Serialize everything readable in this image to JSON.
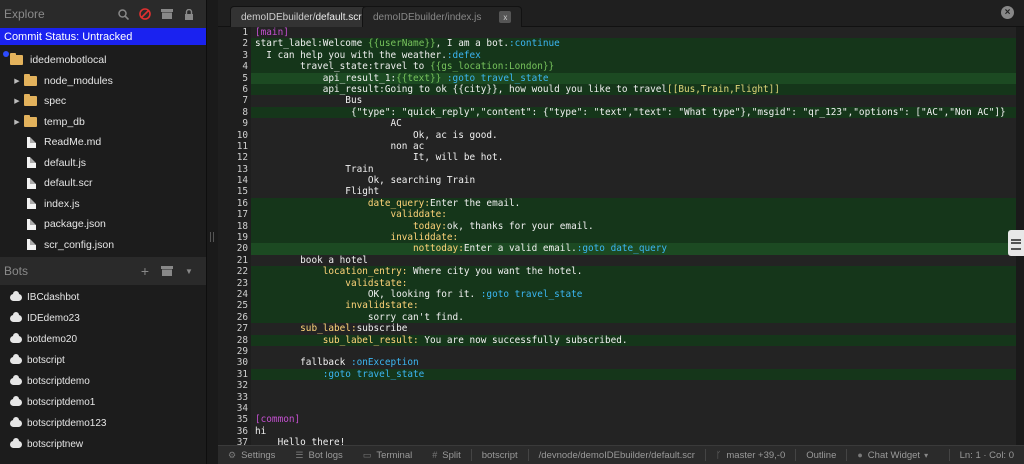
{
  "sidebar": {
    "explore_title": "Explore",
    "commit_status": "Commit Status: Untracked",
    "tree": [
      {
        "name": "idedemobotlocal",
        "kind": "folder",
        "level": 0,
        "arrow": ""
      },
      {
        "name": "node_modules",
        "kind": "folder",
        "level": 1,
        "arrow": "▶"
      },
      {
        "name": "spec",
        "kind": "folder",
        "level": 1,
        "arrow": "▶"
      },
      {
        "name": "temp_db",
        "kind": "folder",
        "level": 1,
        "arrow": "▶"
      },
      {
        "name": "ReadMe.md",
        "kind": "file",
        "level": 1,
        "arrow": ""
      },
      {
        "name": "default.js",
        "kind": "file",
        "level": 1,
        "arrow": ""
      },
      {
        "name": "default.scr",
        "kind": "file",
        "level": 1,
        "arrow": ""
      },
      {
        "name": "index.js",
        "kind": "file",
        "level": 1,
        "arrow": ""
      },
      {
        "name": "package.json",
        "kind": "file",
        "level": 1,
        "arrow": ""
      },
      {
        "name": "scr_config.json",
        "kind": "file",
        "level": 1,
        "arrow": ""
      }
    ],
    "bots_title": "Bots",
    "bots": [
      "IBCdashbot",
      "IDEdemo23",
      "botdemo20",
      "botscript",
      "botscriptdemo",
      "botscriptdemo1",
      "botscriptdemo123",
      "botscriptnew"
    ]
  },
  "tabs": [
    {
      "prefix": "demoIDEbuilder/",
      "file": "default.scr",
      "active": true
    },
    {
      "prefix": "demoIDEbuilder/",
      "file": "index.js",
      "active": false
    }
  ],
  "code_lines": [
    {
      "n": "1",
      "hl": "",
      "segs": [
        {
          "t": "[main]",
          "c": "c-sect"
        }
      ]
    },
    {
      "n": "2",
      "hl": "hl",
      "segs": [
        {
          "t": "start_label:",
          "c": ""
        },
        {
          "t": "Welcome ",
          "c": ""
        },
        {
          "t": "{{userName}}",
          "c": "c-var"
        },
        {
          "t": ", I am a bot.",
          "c": ""
        },
        {
          "t": ":continue",
          "c": "c-goto"
        }
      ]
    },
    {
      "n": "3",
      "hl": "hl",
      "segs": [
        {
          "t": "  I can help you with the weather.",
          "c": ""
        },
        {
          "t": ":defex",
          "c": "c-goto"
        }
      ]
    },
    {
      "n": "4",
      "hl": "hl",
      "segs": [
        {
          "t": "        travel_state:",
          "c": ""
        },
        {
          "t": "travel to ",
          "c": ""
        },
        {
          "t": "{{gs_location:London}}",
          "c": "c-var"
        }
      ]
    },
    {
      "n": "5",
      "hl": "hl2",
      "segs": [
        {
          "t": "            api_result_1:",
          "c": ""
        },
        {
          "t": "{{text}}",
          "c": "c-var"
        },
        {
          "t": " :goto travel_state",
          "c": "c-goto"
        }
      ]
    },
    {
      "n": "6",
      "hl": "hl",
      "segs": [
        {
          "t": "            api_result:",
          "c": ""
        },
        {
          "t": "Going to ok {{city}}, how would you like to travel",
          "c": ""
        },
        {
          "t": "[[Bus,Train,Flight]]",
          "c": "c-brk"
        }
      ]
    },
    {
      "n": "7",
      "hl": "",
      "segs": [
        {
          "t": "                Bus",
          "c": ""
        }
      ]
    },
    {
      "n": "8",
      "hl": "hl",
      "segs": [
        {
          "t": "                 {\"type\": \"quick_reply\",\"content\": {\"type\": \"text\",\"text\": \"What type\"},\"msgid\": \"qr_123\",\"options\": [\"AC\",\"Non AC\"]}",
          "c": ""
        }
      ]
    },
    {
      "n": "9",
      "hl": "",
      "segs": [
        {
          "t": "                        AC",
          "c": ""
        }
      ]
    },
    {
      "n": "10",
      "hl": "",
      "segs": [
        {
          "t": "                            Ok, ac is good.",
          "c": ""
        }
      ]
    },
    {
      "n": "11",
      "hl": "",
      "segs": [
        {
          "t": "                        non ac",
          "c": ""
        }
      ]
    },
    {
      "n": "12",
      "hl": "",
      "segs": [
        {
          "t": "                            It, will be hot.",
          "c": ""
        }
      ]
    },
    {
      "n": "13",
      "hl": "",
      "segs": [
        {
          "t": "                Train",
          "c": ""
        }
      ]
    },
    {
      "n": "14",
      "hl": "",
      "segs": [
        {
          "t": "                    Ok, searching Train",
          "c": ""
        }
      ]
    },
    {
      "n": "15",
      "hl": "",
      "segs": [
        {
          "t": "                Flight",
          "c": ""
        }
      ]
    },
    {
      "n": "16",
      "hl": "hl",
      "segs": [
        {
          "t": "                    date_query:",
          "c": "c-label"
        },
        {
          "t": "Enter the email.",
          "c": ""
        }
      ]
    },
    {
      "n": "17",
      "hl": "hl",
      "segs": [
        {
          "t": "                        validdate:",
          "c": "c-label"
        }
      ]
    },
    {
      "n": "18",
      "hl": "hl",
      "segs": [
        {
          "t": "                            today:",
          "c": "c-label"
        },
        {
          "t": "ok, thanks for your email.",
          "c": ""
        }
      ]
    },
    {
      "n": "19",
      "hl": "hl",
      "segs": [
        {
          "t": "                        invaliddate:",
          "c": "c-label"
        }
      ]
    },
    {
      "n": "20",
      "hl": "hl2",
      "segs": [
        {
          "t": "                            nottoday:",
          "c": "c-label"
        },
        {
          "t": "Enter a valid email.",
          "c": ""
        },
        {
          "t": ":goto date_query",
          "c": "c-goto"
        }
      ]
    },
    {
      "n": "21",
      "hl": "",
      "segs": [
        {
          "t": "        book a hotel",
          "c": ""
        }
      ]
    },
    {
      "n": "22",
      "hl": "hl",
      "segs": [
        {
          "t": "            location_entry:",
          "c": "c-label"
        },
        {
          "t": " Where city you want the hotel.",
          "c": ""
        }
      ]
    },
    {
      "n": "23",
      "hl": "hl",
      "segs": [
        {
          "t": "                validstate:",
          "c": "c-label"
        }
      ]
    },
    {
      "n": "24",
      "hl": "hl",
      "segs": [
        {
          "t": "                    OK, looking for it. ",
          "c": ""
        },
        {
          "t": ":goto travel_state",
          "c": "c-goto"
        }
      ]
    },
    {
      "n": "25",
      "hl": "hl",
      "segs": [
        {
          "t": "                invalidstate:",
          "c": "c-label"
        }
      ]
    },
    {
      "n": "26",
      "hl": "hl",
      "segs": [
        {
          "t": "                    sorry can't find.",
          "c": ""
        }
      ]
    },
    {
      "n": "27",
      "hl": "",
      "segs": [
        {
          "t": "        sub_label:",
          "c": "c-label"
        },
        {
          "t": "subscribe",
          "c": ""
        }
      ]
    },
    {
      "n": "28",
      "hl": "hl",
      "segs": [
        {
          "t": "            sub_label_result:",
          "c": "c-label"
        },
        {
          "t": " You are now successfully subscribed.",
          "c": ""
        }
      ]
    },
    {
      "n": "29",
      "hl": "",
      "segs": [
        {
          "t": "",
          "c": ""
        }
      ]
    },
    {
      "n": "30",
      "hl": "",
      "segs": [
        {
          "t": "        fallback ",
          "c": ""
        },
        {
          "t": ":onException",
          "c": "c-goto"
        }
      ]
    },
    {
      "n": "31",
      "hl": "hl",
      "segs": [
        {
          "t": "            ",
          "c": ""
        },
        {
          "t": ":goto travel_state",
          "c": "c-goto"
        }
      ]
    },
    {
      "n": "32",
      "hl": "",
      "segs": [
        {
          "t": "",
          "c": ""
        }
      ]
    },
    {
      "n": "33",
      "hl": "",
      "segs": [
        {
          "t": "",
          "c": ""
        }
      ]
    },
    {
      "n": "34",
      "hl": "",
      "segs": [
        {
          "t": "",
          "c": ""
        }
      ]
    },
    {
      "n": "35",
      "hl": "",
      "segs": [
        {
          "t": "[common]",
          "c": "c-sect"
        }
      ]
    },
    {
      "n": "36",
      "hl": "",
      "segs": [
        {
          "t": "hi",
          "c": ""
        }
      ]
    },
    {
      "n": "37",
      "hl": "",
      "segs": [
        {
          "t": "    Hello there!",
          "c": ""
        }
      ]
    }
  ],
  "statusbar": {
    "settings": "Settings",
    "bot_logs": "Bot logs",
    "terminal": "Terminal",
    "split": "Split",
    "botscript": "botscript",
    "path": "/devnode/demoIDEbuilder/default.scr",
    "git": "master +39,-0",
    "outline": "Outline",
    "chat_widget": "Chat Widget",
    "cursor": "Ln: 1 · Col: 0"
  }
}
